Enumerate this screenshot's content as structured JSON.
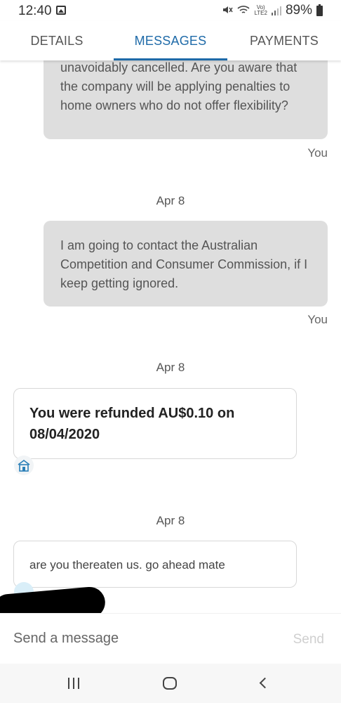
{
  "status_bar": {
    "time": "12:40",
    "gallery_icon": "image-icon",
    "mute_icon": "mute-icon",
    "wifi_icon": "wifi-icon",
    "network": "VoLTE2",
    "battery": "89%"
  },
  "tabs": [
    {
      "label": "DETAILS"
    },
    {
      "label": "MESSAGES",
      "active": true
    },
    {
      "label": "PAYMENTS"
    }
  ],
  "messages": {
    "msg1_text": "social-distancing laws making this trip unavoidably cancelled. Are you aware that the company will be applying penalties to home owners who do not offer flexibility?",
    "msg1_sender": "You",
    "date2": "Apr 8",
    "msg2_text": "I am going to contact the Australian Competition and Consumer Commission, if I keep getting ignored.",
    "msg2_sender": "You",
    "date3": "Apr 8",
    "refund_text": "You were refunded AU$0.10 on 08/04/2020",
    "date4": "Apr 8",
    "reply_text": "are you thereaten us. go ahead mate"
  },
  "composer": {
    "placeholder": "Send a message",
    "send_label": "Send"
  },
  "nav": {
    "recent": "recent-apps-icon",
    "home": "home-icon",
    "back": "back-icon"
  },
  "colors": {
    "accent": "#1e6aa8",
    "bubble_out": "#dedede",
    "bubble_in_border": "#d8d8d8"
  }
}
